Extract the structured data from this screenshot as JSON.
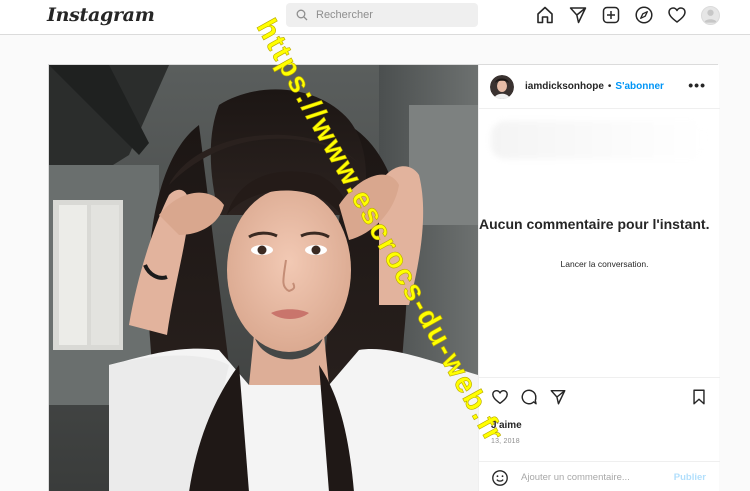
{
  "header": {
    "logo": "Instagram",
    "search_placeholder": "Rechercher",
    "nav_icons": [
      "home-icon",
      "direct-icon",
      "new-post-icon",
      "explore-icon",
      "activity-icon",
      "profile-avatar"
    ]
  },
  "post": {
    "username": "iamdicksonhope",
    "separator": "•",
    "follow_label": "S'abonner",
    "more_label": "•••",
    "no_comments_title": "Aucun commentaire pour l'instant.",
    "start_conversation": "Lancer la conversation.",
    "likes_label": "J'aime",
    "date_label": "13, 2018",
    "comment_placeholder": "Ajouter un commentaire...",
    "publish_label": "Publier"
  },
  "watermark": {
    "text": "https://www.escrocs-du-web.fr",
    "color": "#ffff00"
  },
  "colors": {
    "link_blue": "#0095f6",
    "publish_disabled": "#b2dffc",
    "border": "#dbdbdb"
  }
}
